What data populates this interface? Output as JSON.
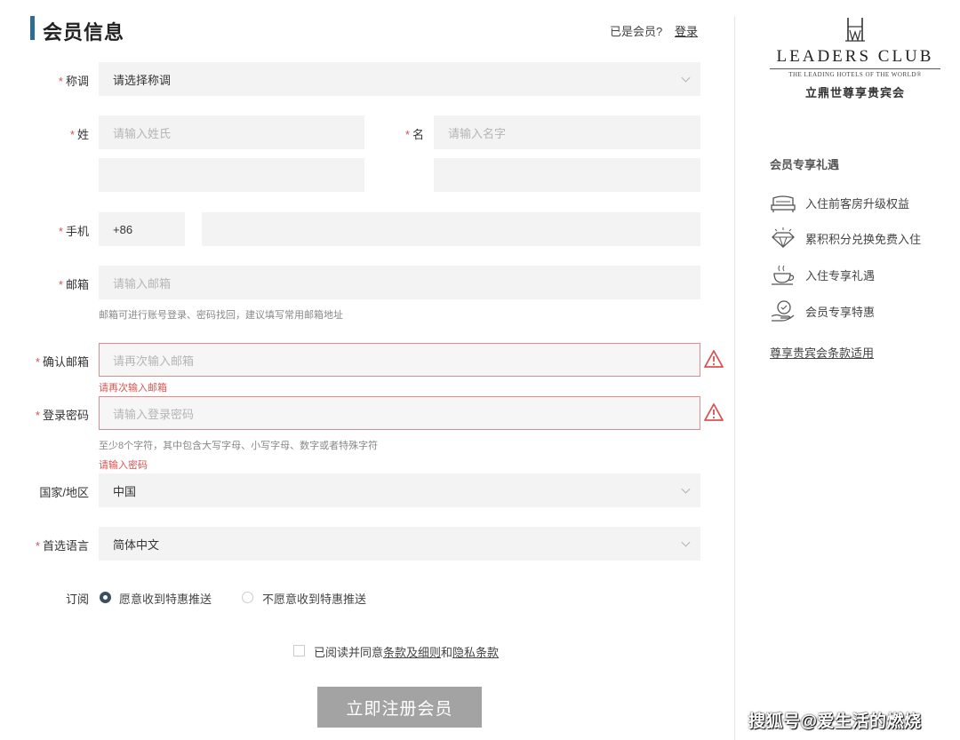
{
  "header": {
    "title": "会员信息",
    "member_question": "已是会员?",
    "login_label": "登录"
  },
  "form": {
    "salutation": {
      "label": "称调",
      "value": "请选择称调"
    },
    "surname": {
      "label": "姓",
      "placeholder": "请输入姓氏"
    },
    "given_name": {
      "label": "名",
      "placeholder": "请输入名字"
    },
    "phone": {
      "label": "手机",
      "country_code": "+86",
      "value": ""
    },
    "email": {
      "label": "邮箱",
      "placeholder": "请输入邮箱",
      "hint": "邮箱可进行账号登录、密码找回，建议填写常用邮箱地址"
    },
    "confirm_email": {
      "label": "确认邮箱",
      "placeholder": "请再次输入邮箱",
      "error": "请再次输入邮箱"
    },
    "password": {
      "label": "登录密码",
      "placeholder": "请输入登录密码",
      "hint": "至少8个字符，其中包含大写字母、小写字母、数字或者特殊字符",
      "error": "请输入密码"
    },
    "country": {
      "label": "国家/地区",
      "value": "中国"
    },
    "language": {
      "label": "首选语言",
      "value": "简体中文"
    },
    "subscribe": {
      "label": "订阅",
      "options": [
        "愿意收到特惠推送",
        "不愿意收到特惠推送"
      ],
      "selected_index": 0
    },
    "required_mark": "*",
    "agreement": {
      "prefix": "已阅读并同意",
      "terms_link": "条款及细则",
      "and": "和",
      "privacy_link": "隐私条款",
      "checked": false
    },
    "submit_label": "立即注册会员"
  },
  "sidebar": {
    "brand_name": "LEADERS CLUB",
    "brand_tagline": "THE LEADING HOTELS OF THE WORLD®",
    "brand_cn": "立鼎世尊享贵宾会",
    "benefits_title": "会员专享礼遇",
    "benefits": [
      {
        "icon": "bed-icon",
        "label": "入住前客房升级权益"
      },
      {
        "icon": "diamond-icon",
        "label": "累积积分兑换免费入住"
      },
      {
        "icon": "coffee-cup-icon",
        "label": "入住专享礼遇"
      },
      {
        "icon": "member-hand-icon",
        "label": "会员专享特惠"
      }
    ],
    "terms_link": "尊享贵宾会条款适用"
  },
  "watermark": "搜狐号@爱生活的燃烧",
  "colors": {
    "accent": "#2a6f8f",
    "error": "#d9534f",
    "submit_bg": "#a3a3a3"
  }
}
